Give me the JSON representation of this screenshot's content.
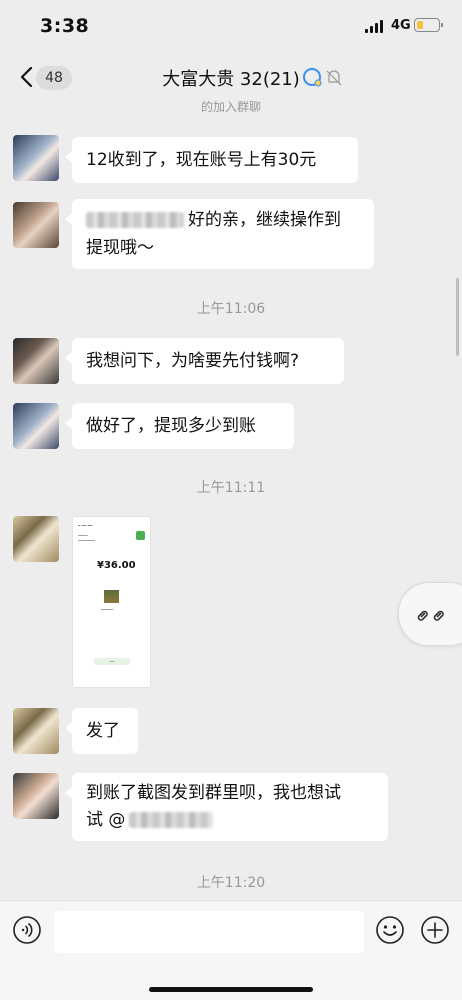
{
  "status_bar": {
    "time": "3:38",
    "network": "4G",
    "battery_level": 0.3,
    "battery_color": "#f3c23a"
  },
  "nav": {
    "unread_count": "48",
    "title": "大富大贵 32(21)",
    "title_icons": [
      "chat-bubble-icon",
      "mute-bell-icon"
    ]
  },
  "system_notice": "的加入群聊",
  "messages": [
    {
      "type": "text",
      "text": "12收到了，现在账号上有30元"
    },
    {
      "type": "text",
      "line1": "好的亲，继续操作到",
      "line2": "提现哦～",
      "has_redacted_mention": true
    },
    {
      "type": "timestamp",
      "text": "上午11:06"
    },
    {
      "type": "text",
      "text": "我想问下，为啥要先付钱啊?"
    },
    {
      "type": "text",
      "text": "做好了，提现多少到账"
    },
    {
      "type": "timestamp",
      "text": "上午11:11"
    },
    {
      "type": "image",
      "amount": "¥36.00"
    },
    {
      "type": "text",
      "text": "发了"
    },
    {
      "type": "text",
      "line1": "到账了截图发到群里呗，我也想试",
      "line2_prefix": "试 @",
      "has_redacted_mention": true
    },
    {
      "type": "timestamp",
      "text": "上午11:20"
    }
  ],
  "colors": {
    "background": "#ededed",
    "bubble": "#ffffff",
    "accent_green": "#4caf50"
  }
}
